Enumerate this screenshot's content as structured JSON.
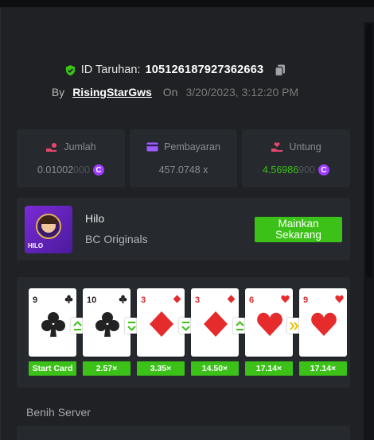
{
  "bet": {
    "id_label": "ID Taruhan:",
    "id_value": "105126187927362663",
    "by_label": "By",
    "username": "RisingStarGws",
    "on_label": "On",
    "timestamp": "3/20/2023, 3:12:20 PM"
  },
  "stats": {
    "amount": {
      "label": "Jumlah",
      "value_main": "0.01002",
      "value_dim": "000",
      "icon": "hand-coin-icon"
    },
    "payout": {
      "label": "Pembayaran",
      "value": "457.0748 x",
      "icon": "wallet-card-icon"
    },
    "profit": {
      "label": "Untung",
      "value_main": "4.56986",
      "value_dim": "900",
      "icon": "hand-heart-icon"
    },
    "coin_symbol": "C"
  },
  "game": {
    "name": "Hilo",
    "provider": "BC Originals",
    "thumb_label": "HILO",
    "play_button": "Mainkan Sekarang"
  },
  "cards": [
    {
      "rank": "9",
      "suit": "clubs",
      "color": "black",
      "multiplier": "Start Card",
      "next": "higher"
    },
    {
      "rank": "10",
      "suit": "clubs",
      "color": "black",
      "multiplier": "2.57×",
      "next": "lower"
    },
    {
      "rank": "3",
      "suit": "diamonds",
      "color": "red",
      "multiplier": "3.35×",
      "next": "lower"
    },
    {
      "rank": "3",
      "suit": "diamonds",
      "color": "red",
      "multiplier": "14.50×",
      "next": "higher"
    },
    {
      "rank": "6",
      "suit": "hearts",
      "color": "red",
      "multiplier": "17.14×",
      "next": "skip"
    },
    {
      "rank": "9",
      "suit": "hearts",
      "color": "red",
      "multiplier": "17.14×",
      "next": ""
    }
  ],
  "seed": {
    "label": "Benih Server"
  },
  "colors": {
    "accent_green": "#3bc117",
    "coin_purple": "#9d3cff",
    "panel_bg": "#262a2e"
  }
}
